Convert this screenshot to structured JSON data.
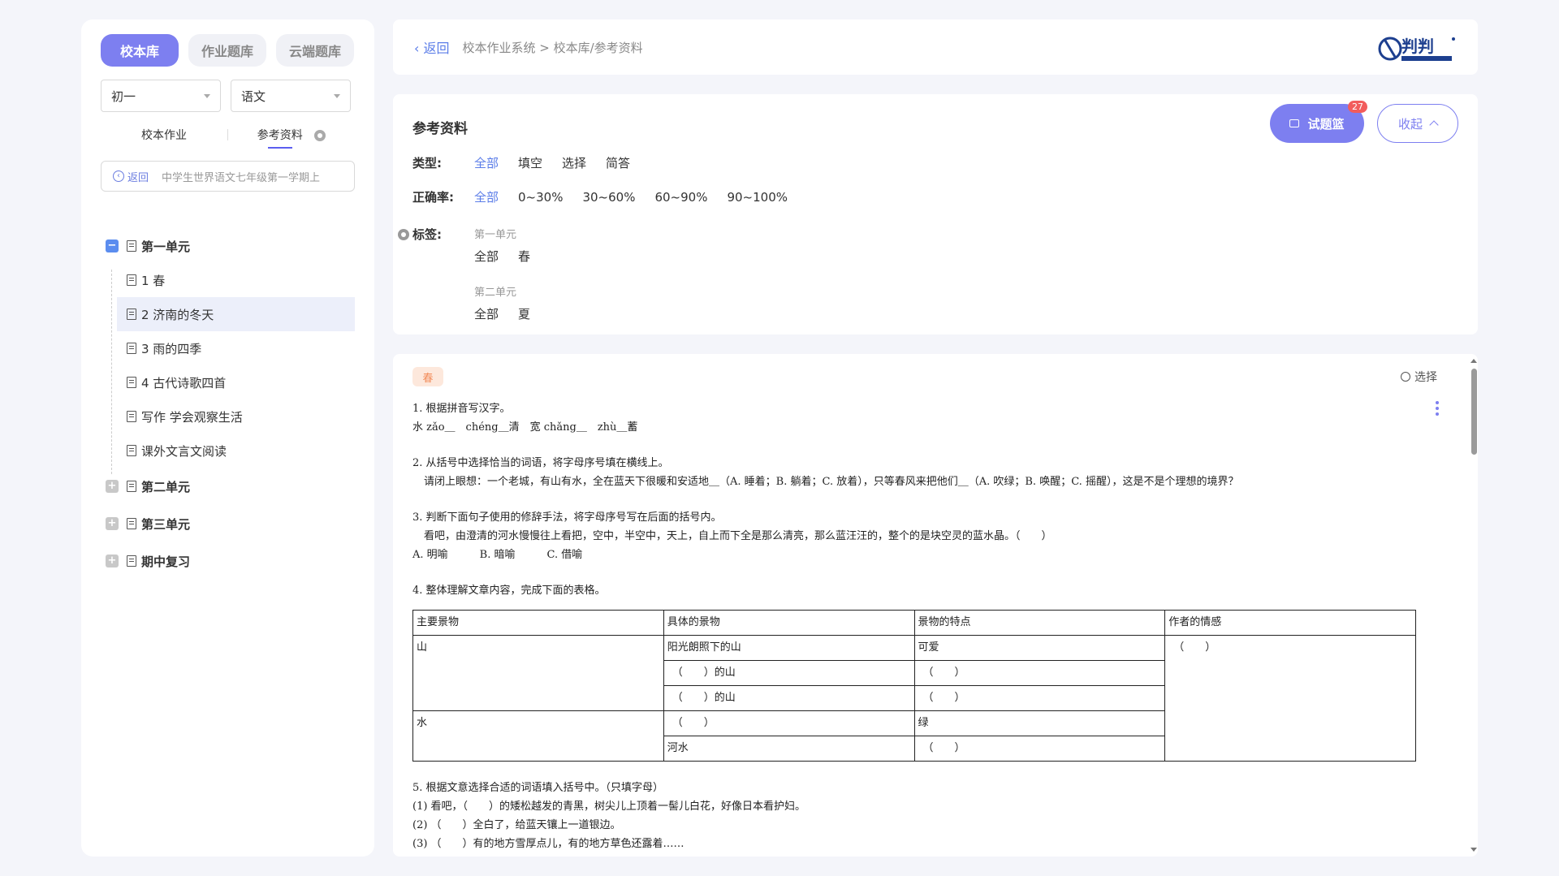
{
  "library_tabs": [
    "校本库",
    "作业题库",
    "云端题库"
  ],
  "grade_select": "初一",
  "subject_select": "语文",
  "sub_tabs": {
    "homework": "校本作业",
    "reference": "参考资料"
  },
  "path_box": {
    "back": "返回",
    "path": "中学生世界语文七年级第一学期上"
  },
  "tree": {
    "unit1": "第一单元",
    "lessons": [
      "1 春",
      "2 济南的冬天",
      "3 雨的四季",
      "4 古代诗歌四首",
      "写作 学会观察生活",
      "课外文言文阅读"
    ],
    "unit2": "第二单元",
    "unit3": "第三单元",
    "review": "期中复习"
  },
  "topbar": {
    "back": "返回",
    "breadcrumb": "校本作业系统 > 校本库/参考资料"
  },
  "logo": {
    "text": "判判"
  },
  "filter": {
    "title": "参考资料",
    "basket_label": "试题篮",
    "basket_count": "27",
    "collapse_label": "收起",
    "type_label": "类型:",
    "type_options": [
      "全部",
      "填空",
      "选择",
      "简答"
    ],
    "accuracy_label": "正确率:",
    "accuracy_options": [
      "全部",
      "0~30%",
      "30~60%",
      "60~90%",
      "90~100%"
    ],
    "tag_label": "标签:",
    "tag_groups": [
      {
        "name": "第一单元",
        "options": [
          "全部",
          "春"
        ]
      },
      {
        "name": "第二单元",
        "options": [
          "全部",
          "夏"
        ]
      }
    ]
  },
  "content": {
    "chip": "春",
    "select_label": "选择",
    "q1": [
      "1. 根据拼音写汉字。",
      "水 zǎo＿　chéng＿清　宽 chǎng＿　zhù＿蓄"
    ],
    "q2": [
      "2. 从括号中选择恰当的词语，将字母序号填在横线上。",
      "请闭上眼想：一个老城，有山有水，全在蓝天下很暖和安适地＿（A. 睡着；B. 躺着；C. 放着），只等春风来把他们＿（A. 吹绿；B. 唤醒；C. 摇醒），这是不是个理想的境界？"
    ],
    "q3": [
      "3. 判断下面句子使用的修辞手法，将字母序号写在后面的括号内。",
      "看吧，由澄清的河水慢慢往上看把，空中，半空中，天上，自上而下全是那么清亮，那么蓝汪汪的，整个的是块空灵的蓝水晶。（　　）",
      "A. 明喻　　　B. 暗喻　　　C. 借喻"
    ],
    "q4": "4. 整体理解文章内容，完成下面的表格。",
    "table": {
      "headers": [
        "主要景物",
        "具体的景物",
        "景物的特点",
        "作者的情感"
      ],
      "mountain": "山",
      "water": "水",
      "r1": [
        "阳光朗照下的山",
        "可爱",
        "（　　）"
      ],
      "r2": [
        "（　　）的山",
        "（　　）"
      ],
      "r3": [
        "（　　）的山",
        "（　　）"
      ],
      "r4": [
        "（　　）",
        "绿"
      ],
      "r5": [
        "河水",
        "（　　）"
      ]
    },
    "q5": [
      "5. 根据文意选择合适的词语填入括号中。（只填字母）",
      "(1) 看吧，（　　）的矮松越发的青黑，树尖儿上顶着一髻儿白花，好像日本看护妇。",
      "(2) （　　）全白了，给蓝天镶上一道银边。",
      "(3) （　　）有的地方雪厚点儿，有的地方草色还露着……"
    ]
  }
}
